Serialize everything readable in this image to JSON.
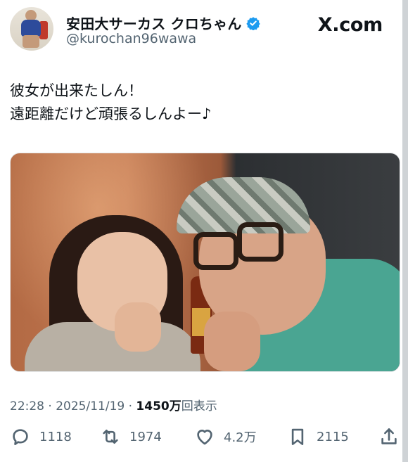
{
  "header": {
    "display_name": "安田大サーカス クロちゃん",
    "handle": "@kurochan96wawa",
    "site_label": "X.com",
    "verified_color": "#1d9bf0"
  },
  "tweet": {
    "lines": [
      "彼女が出来たしん！",
      "遠距離だけど頑張るしんよー♪"
    ]
  },
  "meta": {
    "time": "22:28",
    "separator": " · ",
    "date": "2025/11/19",
    "views_number": "1450万",
    "views_label": "回表示"
  },
  "actions": {
    "reply_count": "1118",
    "repost_count": "1974",
    "like_count": "4.2万",
    "bookmark_count": "2115"
  },
  "icons": {
    "reply": "speech-bubble-icon",
    "repost": "repost-arrows-icon",
    "like": "heart-icon",
    "bookmark": "bookmark-icon",
    "share": "share-upload-icon"
  }
}
